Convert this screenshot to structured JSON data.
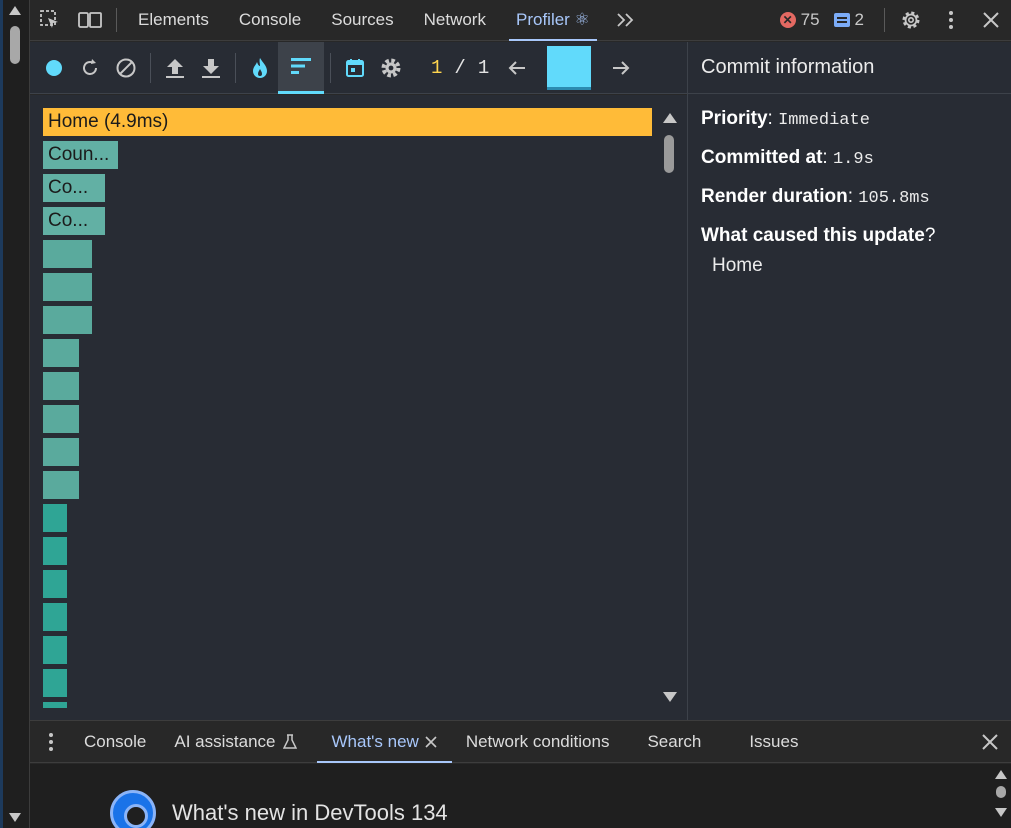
{
  "topbar": {
    "tabs": [
      {
        "label": "Elements"
      },
      {
        "label": "Console"
      },
      {
        "label": "Sources"
      },
      {
        "label": "Network"
      },
      {
        "label": "Profiler ⚛"
      }
    ],
    "error_count": "75",
    "message_count": "2"
  },
  "profiler": {
    "commit_current": "1",
    "commit_separator": "/",
    "commit_total": "1",
    "flame_nodes": [
      {
        "label": "Home (4.9ms)",
        "color": "#ffbb38"
      },
      {
        "label": "Coun...",
        "color": "#62b0a4"
      },
      {
        "label": "Co...",
        "color": "#62b0a4"
      },
      {
        "label": "Co...",
        "color": "#62b0a4"
      }
    ]
  },
  "commit_info": {
    "title": "Commit information",
    "priority_label": "Priority",
    "priority_value": "Immediate",
    "committed_label": "Committed at",
    "committed_value": "1.9s",
    "render_label": "Render duration",
    "render_value": "105.8ms",
    "cause_label": "What caused this update",
    "cause_value": "Home"
  },
  "drawer": {
    "tabs": [
      {
        "label": "Console"
      },
      {
        "label": "AI assistance"
      },
      {
        "label": "What's new"
      },
      {
        "label": "Network conditions"
      },
      {
        "label": "Search"
      },
      {
        "label": "Issues"
      }
    ],
    "whats_new_title": "What's new in DevTools 134"
  },
  "colors": {
    "accent": "#61dafb",
    "selected_commit": "#ffbb38",
    "active_tab": "#a8c7fa",
    "counter_current": "#ffd54f"
  }
}
